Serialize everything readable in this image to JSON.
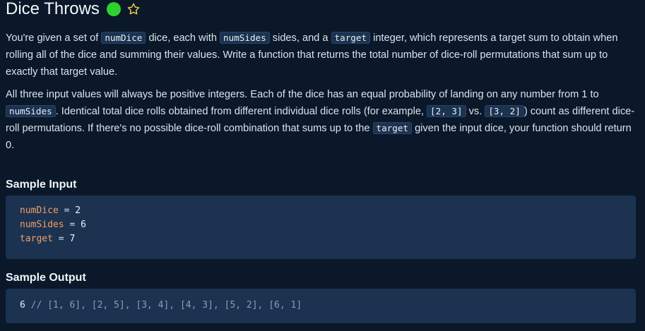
{
  "header": {
    "title": "Dice Throws",
    "status_color": "#2fd12f",
    "status_icon": "status-dot-icon",
    "favorite_icon": "star-icon"
  },
  "description": {
    "paragraph_1": {
      "text_1": "You're given a set of ",
      "code_1": "numDice",
      "text_2": " dice, each with ",
      "code_2": "numSides",
      "text_3": " sides, and a ",
      "code_3": "target",
      "text_4": " integer, which represents a target sum to obtain when rolling all of the dice and summing their values. Write a function that returns the total number of dice-roll permutations that sum up to exactly that target value."
    },
    "paragraph_2": {
      "text_1": "All three input values will always be positive integers. Each of the dice has an equal probability of landing on any number from 1 to ",
      "code_1": "numSides",
      "text_2": ". Identical total dice rolls obtained from different individual dice rolls (for example, ",
      "code_2": "[2, 3]",
      "text_3": " vs. ",
      "code_3": "[3, 2]",
      "text_4": ") count as different dice-roll permutations. If there's no possible dice-roll combination that sums up to the ",
      "code_4": "target",
      "text_5": " given the input dice, your function should return 0."
    }
  },
  "sample_input": {
    "title": "Sample Input",
    "lines": [
      {
        "name": "numDice",
        "operator": " = ",
        "value": "2"
      },
      {
        "name": "numSides",
        "operator": " = ",
        "value": "6"
      },
      {
        "name": "target",
        "operator": " = ",
        "value": "7"
      }
    ]
  },
  "sample_output": {
    "title": "Sample Output",
    "value": "6",
    "comment": " // [1, 6], [2, 5], [3, 4], [4, 3], [5, 2], [6, 1]"
  },
  "colors": {
    "background": "#0a1829",
    "code_background": "#1b3251",
    "variable": "#f29f63",
    "comment": "#8c9db1"
  }
}
